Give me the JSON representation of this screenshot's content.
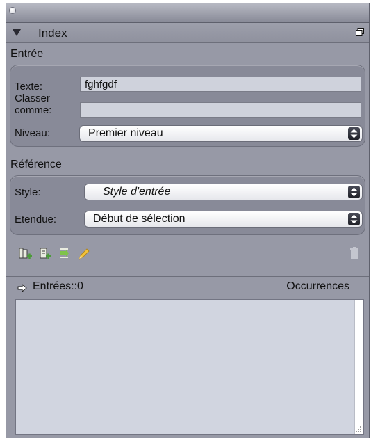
{
  "panel": {
    "title": "Index"
  },
  "entree": {
    "section_label": "Entrée",
    "texte_label": "Texte:",
    "texte_value": "fghfgdf",
    "classer_label_line1": "Classer",
    "classer_label_line2": "comme:",
    "classer_value": "",
    "niveau_label": "Niveau:",
    "niveau_value": "Premier niveau"
  },
  "reference": {
    "section_label": "Référence",
    "style_label": "Style:",
    "style_value": "Style d'entrée",
    "etendue_label": "Etendue:",
    "etendue_value": "Début de sélection"
  },
  "toolbar": {
    "icons": [
      "new-entry-icon",
      "new-page-reference-icon",
      "update-preview-icon",
      "edit-pencil-icon",
      "trash-icon"
    ]
  },
  "list": {
    "entries_label": "Entrées::0",
    "occurrences_label": "Occurrences"
  },
  "colors": {
    "panel_bg": "#9799a6",
    "list_bg": "#d1d5e0",
    "icon_green": "#4c9a3a",
    "pencil_yellow": "#f2c23a"
  }
}
